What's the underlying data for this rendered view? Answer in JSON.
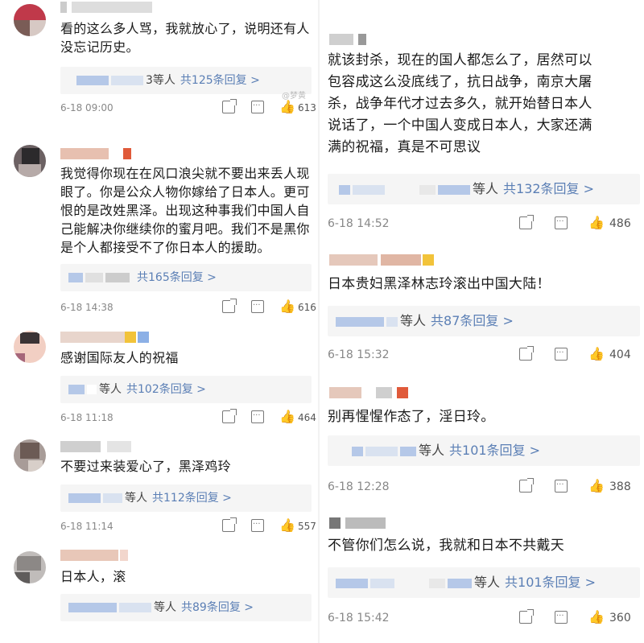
{
  "left": [
    {
      "username": "…",
      "text": [
        "看的这么多人骂，我就放心了，说明还有人",
        "没忘记历史。"
      ],
      "replies": {
        "who": "3等人",
        "count": "共125条回复 >"
      },
      "time": "6-18 09:00",
      "likes": "613",
      "avatar_colors": [
        "#c0394a",
        "#7a5c56",
        "#d7c9c4"
      ]
    },
    {
      "username": "",
      "text": [
        "我觉得你现在在风口浪尖就不要出来丢人现",
        "眼了。你是公众人物你嫁给了日本人。更可",
        "恨的是改姓黑泽。出现这种事我们中国人自",
        "己能解决你继续你的蜜月吧。我们不是黑你",
        "是个人都接受不了你日本人的援助。"
      ],
      "replies": {
        "who": "",
        "count": "共165条回复 >"
      },
      "time": "6-18 14:38",
      "likes": "616",
      "avatar_colors": [
        "#2c2a2c",
        "#6c6163",
        "#b6aaa8"
      ]
    },
    {
      "username": "",
      "text": [
        "感谢国际友人的祝福"
      ],
      "replies": {
        "who": "等人",
        "count": "共102条回复 >"
      },
      "time": "6-18 11:18",
      "likes": "464",
      "avatar_colors": [
        "#f2cfc3",
        "#3b3335",
        "#a6667a"
      ]
    },
    {
      "username": "",
      "text": [
        "不要过来装爱心了，黑泽鸡玲"
      ],
      "replies": {
        "who": "等人",
        "count": "共112条回复 >"
      },
      "time": "6-18 11:14",
      "likes": "557",
      "avatar_colors": [
        "#6c5b55",
        "#a89c98",
        "#d8cfc9"
      ]
    },
    {
      "username": "",
      "text": [
        "日本人，滚"
      ],
      "replies": {
        "who": "等人",
        "count": "共89条回复 >"
      },
      "time": "",
      "likes": "",
      "avatar_colors": [
        "#8c8886",
        "#c0bcba",
        "#5f5c5b"
      ]
    }
  ],
  "right": [
    {
      "username": "",
      "text": [
        "就该封杀，现在的国人都怎么了，居然可以",
        "包容成这么没底线了，抗日战争，南京大屠",
        "杀，战争年代才过去多久，就开始替日本人",
        "说话了，一个中国人变成日本人，大家还满",
        "满的祝福，真是不可思议"
      ],
      "replies": {
        "who": "等人",
        "count": "共132条回复 >"
      },
      "time": "6-18 14:52",
      "likes": "486"
    },
    {
      "username": "",
      "text": [
        "日本贵妇黑泽林志玲滚出中国大陆！"
      ],
      "replies": {
        "who": "等人",
        "count": "共87条回复 >"
      },
      "time": "6-18 15:32",
      "likes": "404"
    },
    {
      "username": "",
      "text": [
        "别再惺惺作态了，淫日玲。"
      ],
      "replies": {
        "who": "等人",
        "count": "共101条回复 >"
      },
      "time": "6-18 12:28",
      "likes": "388"
    },
    {
      "username": "",
      "text": [
        "不管你们怎么说，我就和日本不共戴天"
      ],
      "replies": {
        "who": "等人",
        "count": "共101条回复 >"
      },
      "time": "6-18 15:42",
      "likes": "360"
    }
  ],
  "watermark": "@梦黄"
}
